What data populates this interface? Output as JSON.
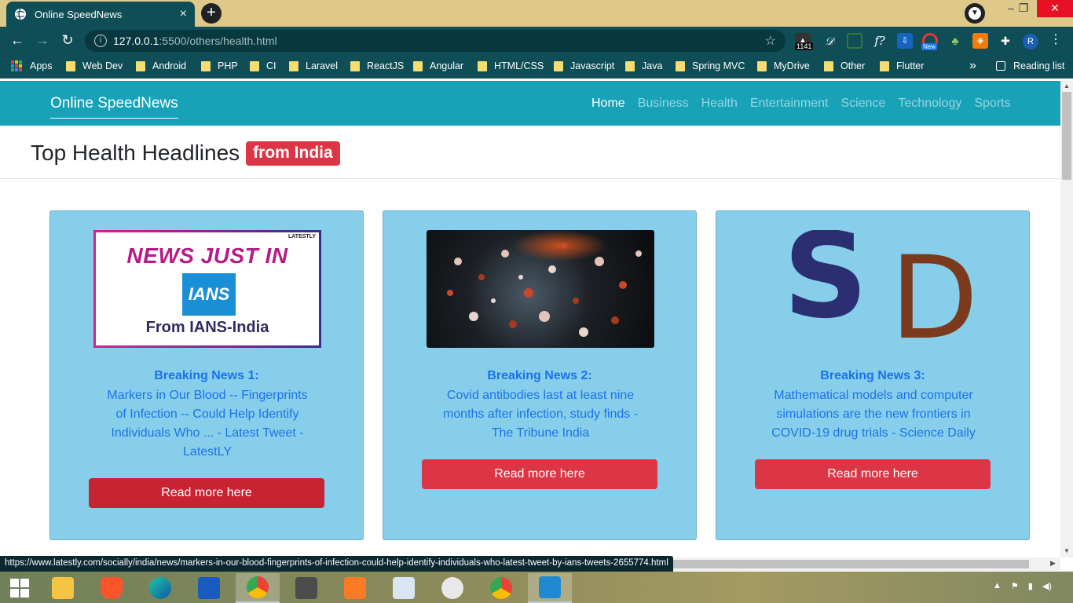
{
  "browser": {
    "tab_title": "Online SpeedNews",
    "tab_close": "×",
    "new_tab": "+",
    "window_minimize": "–",
    "window_maximize": "❐",
    "window_close": "✕",
    "back": "←",
    "forward": "→",
    "reload": "↻",
    "url_host": "127.0.0.1",
    "url_path": ":5500/others/health.html",
    "bookmark_star": "☆",
    "ext_badge_count": "1141",
    "ext_new_label": "New",
    "profile_initial": "R",
    "menu": "⋮",
    "status_url": "https://www.latestly.com/socially/india/news/markers-in-our-blood-fingerprints-of-infection-could-help-identify-individuals-who-latest-tweet-by-ians-tweets-2655774.html"
  },
  "bookmarks": {
    "apps": "Apps",
    "items": [
      "Web Dev",
      "Android",
      "PHP",
      "CI",
      "Laravel",
      "ReactJS",
      "Angular",
      "HTML/CSS",
      "Javascript",
      "Java",
      "Spring MVC",
      "MyDrive",
      "Other",
      "Flutter"
    ],
    "more": "»",
    "reading_list": "Reading list"
  },
  "site": {
    "brand": "Online SpeedNews",
    "nav": [
      "Home",
      "Business",
      "Health",
      "Entertainment",
      "Science",
      "Technology",
      "Sports"
    ],
    "active_nav": "Home",
    "headline": "Top Health Headlines",
    "badge": "from India"
  },
  "cards": [
    {
      "tag": "Breaking News 1:",
      "desc": "Markers in Our Blood -- Fingerprints of Infection -- Could Help Identify Individuals Who ... - Latest Tweet - LatestLY",
      "button": "Read more here",
      "image_text": {
        "headline": "NEWS JUST IN",
        "logo": "IANS",
        "source": "From IANS-India",
        "corner": "LATESTLY"
      }
    },
    {
      "tag": "Breaking News 2:",
      "desc": "Covid antibodies last at least nine months after infection, study finds - The Tribune India",
      "button": "Read more here"
    },
    {
      "tag": "Breaking News 3:",
      "desc": "Mathematical models and computer simulations are the new frontiers in COVID-19 drug trials - Science Daily",
      "button": "Read more here",
      "image_text": {
        "s": "S",
        "d": "D"
      }
    }
  ],
  "colors": {
    "navbar": "#17a2b8",
    "card_bg": "#87ceeb",
    "badge": "#dc3545",
    "link": "#1a73e8"
  }
}
